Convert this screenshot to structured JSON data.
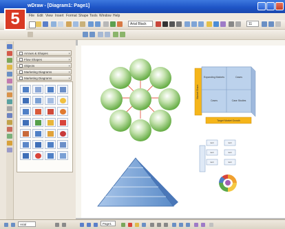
{
  "step_badge": {
    "number": "5",
    "color": "#d93a24"
  },
  "window": {
    "title": "wDraw - [Diagram1: Page1]"
  },
  "menu": {
    "items": [
      "File",
      "Edit",
      "View",
      "Insert",
      "Format",
      "Shape",
      "Tools",
      "Window",
      "Help"
    ]
  },
  "toolbar": {
    "font_name": "Arial Black",
    "font_size": "11"
  },
  "library": {
    "items": [
      {
        "label": "Arrows & Shapes"
      },
      {
        "label": "Flow Shapes"
      },
      {
        "label": "Objects"
      },
      {
        "label": "Marketing Diagrams"
      },
      {
        "label": "Marketing Diagrams"
      }
    ]
  },
  "matrix": {
    "top_left": "Expanding Markets",
    "top_right": "Cases",
    "bottom_left": "Cases",
    "bottom_right": "Case Studies",
    "side_label": "Market Share",
    "caption": "Target Market Growth"
  },
  "grid_table": {
    "cells": [
      "text",
      "text",
      "text",
      "text",
      "text",
      "text"
    ]
  },
  "status": {
    "zoom": "Arial",
    "page_tab": "Page1"
  },
  "colors": {
    "circle_green": "#7fc25a",
    "arrow_red": "#e05a45",
    "pyramid_blue": "#7aa7d8",
    "matrix_blue": "#bcd2ec",
    "label_orange": "#f5b51a"
  }
}
